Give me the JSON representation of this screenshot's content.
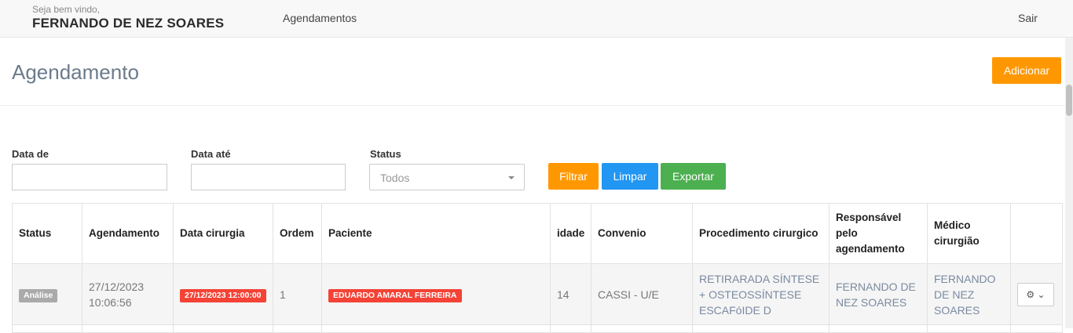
{
  "header": {
    "welcome": "Seja bem vindo,",
    "username": "FERNANDO DE NEZ SOARES",
    "nav_agendamentos": "Agendamentos",
    "nav_sair": "Sair"
  },
  "page": {
    "title": "Agendamento",
    "add_button": "Adicionar"
  },
  "filters": {
    "data_de_label": "Data de",
    "data_de_value": "",
    "data_ate_label": "Data até",
    "data_ate_value": "",
    "status_label": "Status",
    "status_value": "Todos",
    "filtrar": "Filtrar",
    "limpar": "Limpar",
    "exportar": "Exportar"
  },
  "table": {
    "headers": [
      "Status",
      "Agendamento",
      "Data cirurgia",
      "Ordem",
      "Paciente",
      "idade",
      "Convenio",
      "Procedimento cirurgico",
      "Responsável pelo agendamento",
      "Médico cirurgião",
      ""
    ],
    "rows": [
      {
        "status": "Análise",
        "agendamento": "27/12/2023 10:06:56",
        "data_cirurgia": "27/12/2023 12:00:00",
        "ordem": "1",
        "paciente": "EDUARDO AMARAL FERREIRA",
        "idade": "14",
        "convenio": "CASSI - U/E",
        "procedimento": "RETIRARADA SÍNTESE + OSTEOSSÍNTESE ESCAFóIDE D",
        "responsavel": "FERNANDO DE NEZ SOARES",
        "medico": "FERNANDO DE NEZ SOARES",
        "action_icon": "gear-icon"
      }
    ]
  },
  "colors": {
    "orange": "#ff9800",
    "blue": "#2196f3",
    "green": "#4caf50",
    "red": "#f44336"
  }
}
